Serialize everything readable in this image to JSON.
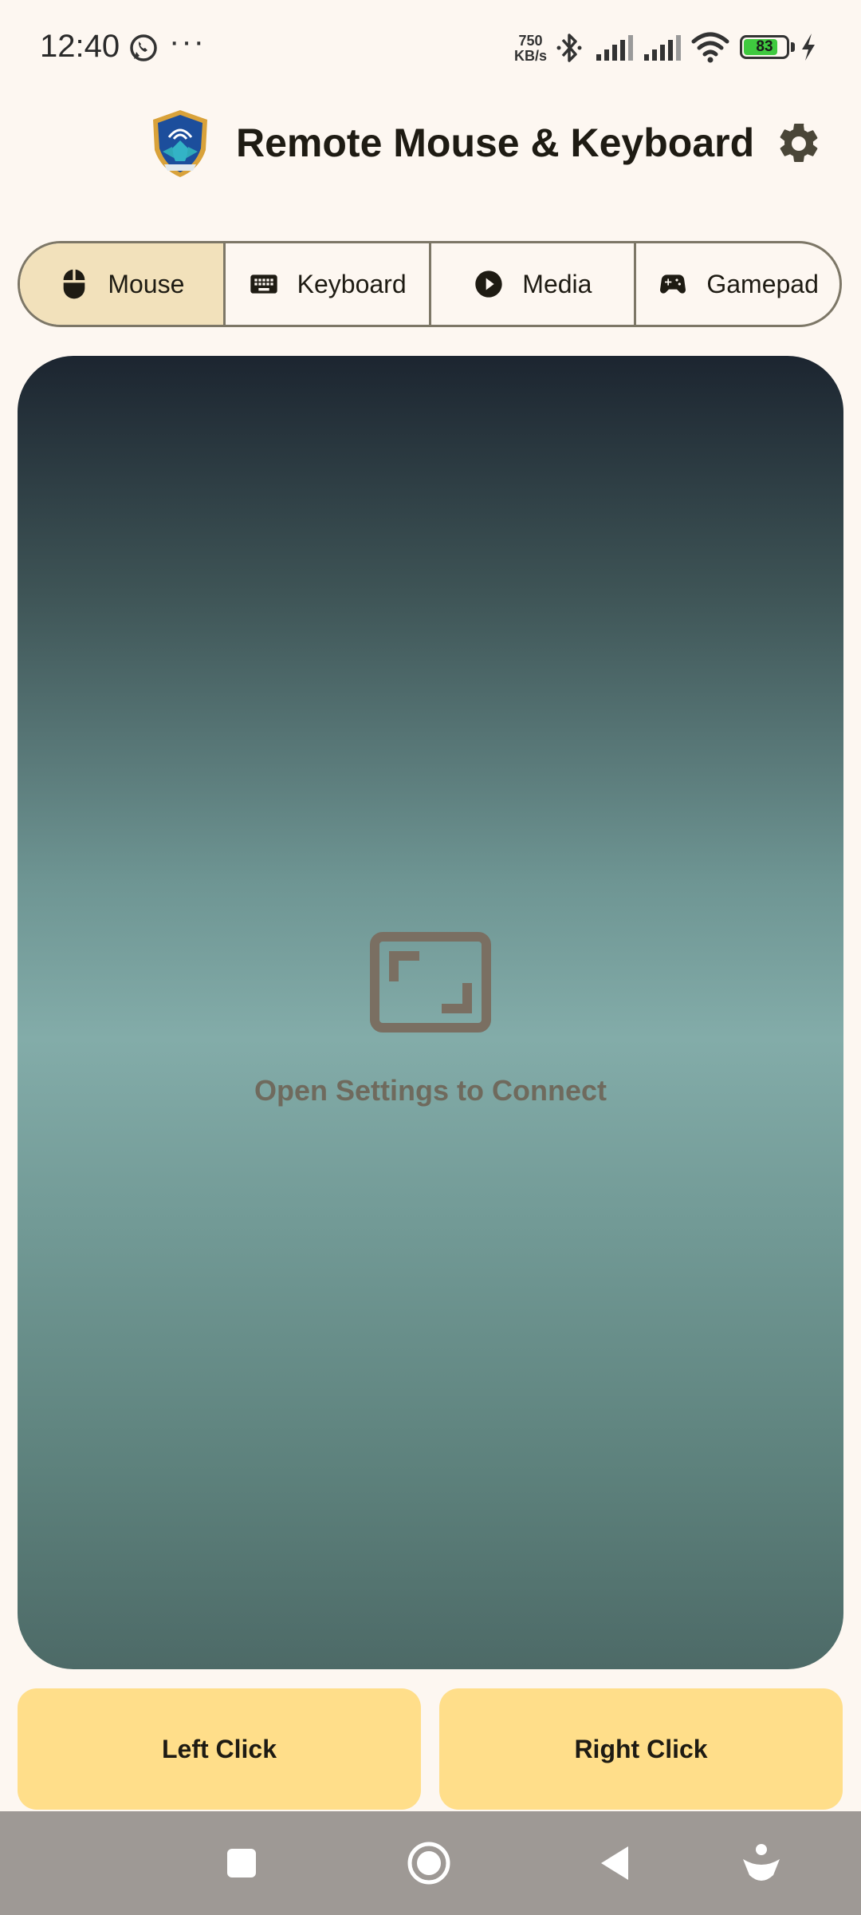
{
  "status_bar": {
    "time": "12:40",
    "network_speed_value": "750",
    "network_speed_unit": "KB/s",
    "battery_level": "83",
    "battery_fraction": 0.83
  },
  "app_bar": {
    "title": "Remote Mouse & Keyboard",
    "logo_icon": "shield-logo-icon",
    "settings_icon": "gear-icon"
  },
  "tabs": [
    {
      "label": "Mouse",
      "icon": "mouse-icon",
      "selected": true
    },
    {
      "label": "Keyboard",
      "icon": "keyboard-icon",
      "selected": false
    },
    {
      "label": "Media",
      "icon": "play-circle-icon",
      "selected": false
    },
    {
      "label": "Gamepad",
      "icon": "gamepad-icon",
      "selected": false
    }
  ],
  "touchpad": {
    "hint": "Open Settings to Connect",
    "icon": "screen-frame-icon"
  },
  "buttons": {
    "left_click": "Left Click",
    "right_click": "Right Click"
  },
  "nav_bar": {
    "items": [
      "recents-square-icon",
      "home-circle-icon",
      "back-triangle-icon",
      "accessibility-icon"
    ]
  },
  "colors": {
    "background": "#FDF7F1",
    "selected_tab": "#F2E1BB",
    "click_button": "#FFDE8A",
    "touchpad_top": "#1C2530",
    "touchpad_mid": "#83ACA9",
    "touchpad_bottom": "#4D6A67",
    "nav_bar": "#9E9995"
  }
}
